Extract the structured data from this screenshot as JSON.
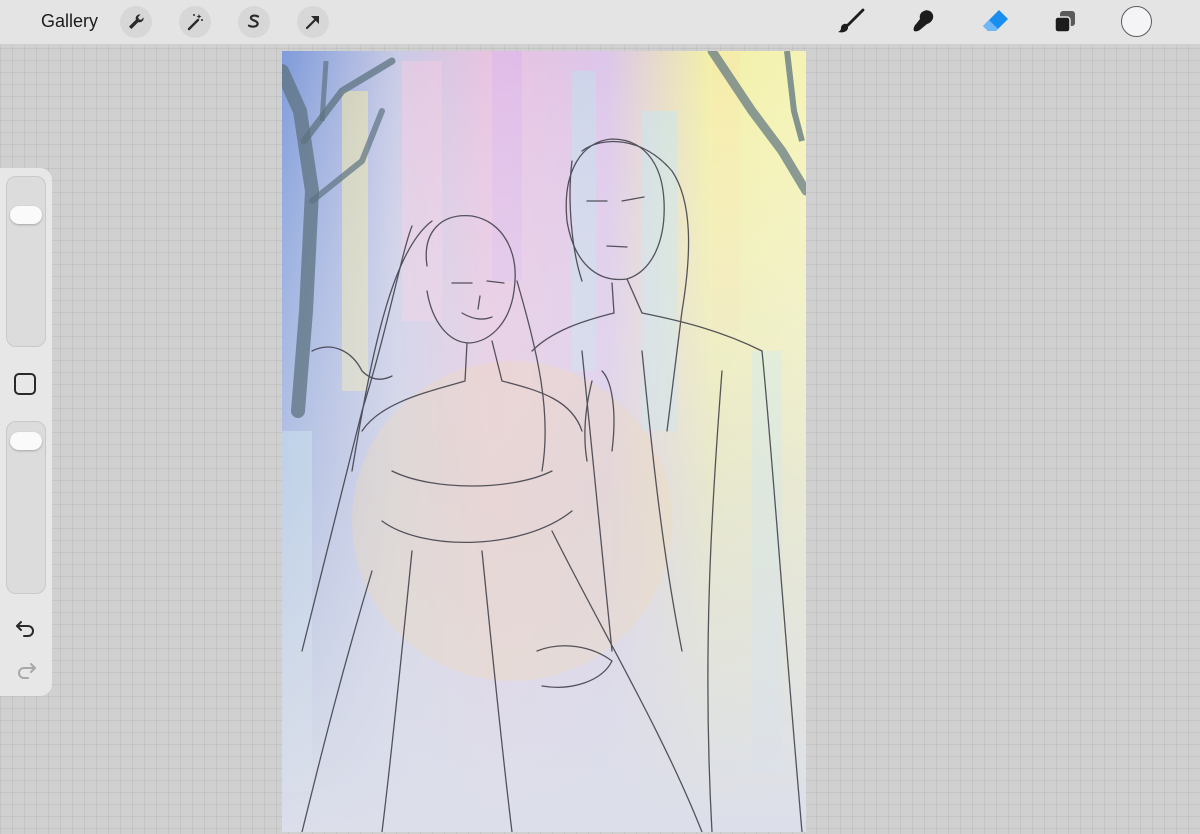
{
  "topbar": {
    "gallery_label": "Gallery",
    "left_tools": [
      "wrench-icon",
      "magic-wand-icon",
      "selection-s-icon",
      "transform-arrow-icon"
    ],
    "right_tools": [
      "brush-icon",
      "smudge-icon",
      "eraser-icon",
      "layers-icon"
    ],
    "active_tool": "eraser",
    "accent_color": "#1a8ef0",
    "current_color": "#f4f4f6"
  },
  "sidebar": {
    "brush_size_level": 0.82,
    "opacity_level": 0.95,
    "modifier": "square-modifier-icon",
    "undo": "undo-arrow-icon",
    "redo": "redo-arrow-icon",
    "redo_enabled": false
  },
  "canvas": {
    "content": "artwork-sketch",
    "palette": [
      "#7f9bd9",
      "#e9c3e0",
      "#f2f0a8",
      "#b9e3ea",
      "#f0d9b8"
    ]
  }
}
